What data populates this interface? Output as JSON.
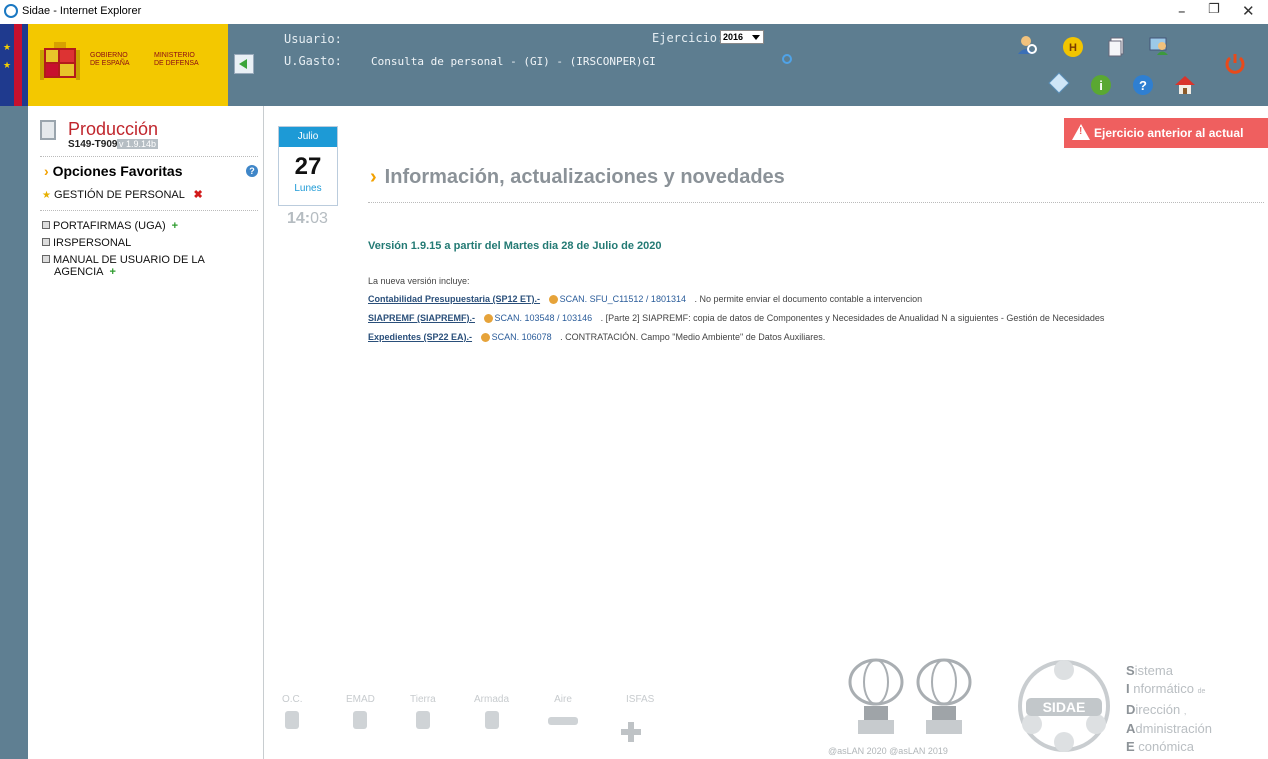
{
  "window": {
    "title": "Sidae - Internet Explorer"
  },
  "header": {
    "gov_line1": "GOBIERNO",
    "gov_line2": "DE ESPAÑA",
    "ministry_line1": "MINISTERIO",
    "ministry_line2": "DE DEFENSA",
    "usuario_label": "Usuario:",
    "ugasto_label": "U.Gasto:",
    "ugasto_value": "Consulta de personal - (GI) - (IRSCONPER)GI",
    "ejercicio_label": "Ejercicio:",
    "ejercicio_value": "2016"
  },
  "sidebar": {
    "prod_title": "Producción",
    "prod_code": "S149-T9091",
    "prod_version": "v 1.9.14b",
    "fav_title": "Opciones Favoritas",
    "fav_item": "GESTIÓN DE PERSONAL",
    "menu": [
      "PORTAFIRMAS (UGA)",
      "IRSPERSONAL",
      "MANUAL DE USUARIO DE LA",
      "AGENCIA"
    ]
  },
  "calendar": {
    "month": "Julio",
    "day": "27",
    "weekday": "Lunes",
    "hour": "14",
    "minute": "03"
  },
  "alert": {
    "text": "Ejercicio anterior al actual"
  },
  "info": {
    "title": "Información, actualizaciones y novedades",
    "version": "Versión 1.9.15 a partir del Martes dia 28 de Julio de 2020",
    "intro": "La nueva versión incluye:",
    "items": [
      {
        "module": "Contabilidad Presupuestaria (SP12 ET).-",
        "scan": "SCAN. SFU_C11512 / 1801314",
        "desc": ". No permite enviar el documento contable a intervencion"
      },
      {
        "module": "SIAPREMF (SIAPREMF).-",
        "scan": "SCAN. 103548 / 103146",
        "desc": ". [Parte 2] SIAPREMF: copia de datos de Componentes y Necesidades de Anualidad N a siguientes - Gestión de Necesidades"
      },
      {
        "module": "Expedientes (SP22 EA).-",
        "scan": "SCAN. 106078",
        "desc": ". CONTRATACIÓN. Campo \"Medio Ambiente\" de Datos Auxiliares."
      }
    ]
  },
  "footer": {
    "logos": [
      "O.C.",
      "EMAD",
      "Tierra",
      "Armada",
      "Aire",
      "ISFAS"
    ],
    "aslan": "@asLAN 2020  @asLAN 2019",
    "sidae_badge": "SIDAE",
    "sidae_lines": [
      {
        "initial": "S",
        "rest": "istema"
      },
      {
        "initial": "I",
        "rest": " nformático",
        "small": "de"
      },
      {
        "initial": "D",
        "rest": "irección",
        "small": ","
      },
      {
        "initial": "A",
        "rest": "dministración"
      },
      {
        "initial": "E",
        "rest": " conómica"
      }
    ]
  }
}
